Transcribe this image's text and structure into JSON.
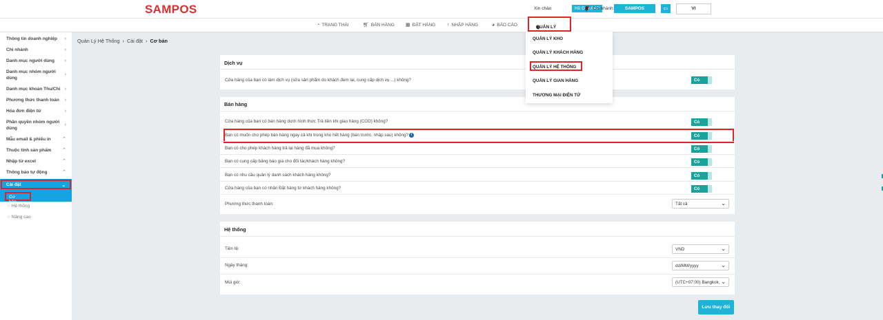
{
  "header": {
    "logo": "SAMPOS",
    "greeting": "Xin chào",
    "user": "Hồ Duy APP",
    "branch_label": "Chi nhánh:",
    "branch": "SAMPOS",
    "language": "VI"
  },
  "nav": {
    "items": [
      {
        "icon": "gauge-icon",
        "label": "TRẠNG THÁI"
      },
      {
        "icon": "cart-icon",
        "label": "BÁN HÀNG"
      },
      {
        "icon": "calendar-icon",
        "label": "ĐẶT HÀNG"
      },
      {
        "icon": "arrow-up-icon",
        "label": "NHẬP HÀNG"
      },
      {
        "icon": "palette-icon",
        "label": "BÁO CÁO"
      }
    ],
    "active": {
      "icon": "gear-icon",
      "label": "QUẢN LÝ"
    },
    "dropdown": [
      "QUẢN LÝ KHO",
      "QUẢN LÝ KHÁCH HÀNG",
      "QUẢN LÝ HỆ THỐNG",
      "QUẢN LÝ GIAN HÀNG",
      "THƯƠNG MẠI ĐIỆN TỬ"
    ]
  },
  "sidebar": {
    "items": [
      "Thông tin doanh nghiệp",
      "Chi nhánh",
      "Danh mục người dùng",
      "Danh mục nhóm người dùng",
      "Danh mục khoản Thu/Chi",
      "Phương thức thanh toán",
      "Hóa đơn điện tử",
      "Phân quyền nhóm người dùng",
      "Mẫu email & phiếu in",
      "Thuộc tính sản phẩm",
      "Nhập từ excel",
      "Thông báo tự động"
    ],
    "active": "Cài đặt",
    "sub": [
      "Cơ bản",
      "Hệ thống",
      "Nâng cao"
    ]
  },
  "breadcrumb": [
    "Quản Lý Hệ Thống",
    "Cài đặt",
    "Cơ bản"
  ],
  "dichvu": {
    "title": "Dịch vụ",
    "rows": [
      {
        "text": "Cửa hàng của bạn có làm dịch vụ (sửa sản phẩm do khách đem lại, cung cấp dịch vụ ...) không?",
        "value": "Có"
      }
    ]
  },
  "banhang": {
    "title": "Bán hàng",
    "rows": [
      {
        "text": "Cửa hàng của bạn có bán hàng dưới hình thức Trả tiền khi giao hàng (COD) không?",
        "value": "Có"
      },
      {
        "text": "Bạn có muốn cho phép bán hàng ngay cả khi trong kho hết hàng (bán trước, nhập sau) không?",
        "value": "Có"
      },
      {
        "text": "Bạn có cho phép khách hàng trả lại hàng đã mua không?",
        "value": "Có"
      },
      {
        "text": "Bạn có cung cấp bảng báo giá cho đối tác/khách hàng không?",
        "value": "Có"
      },
      {
        "text": "Bạn có nhu cầu quản lý danh sách khách hàng không?",
        "value": "Có"
      },
      {
        "text": "Cửa hàng của bạn có nhận Đặt hàng từ khách hàng không?",
        "value": "Có"
      }
    ],
    "payment_label": "Phương thức thanh toán:",
    "payment_value": "Tất cả"
  },
  "hethong": {
    "title": "Hệ thống",
    "rows": [
      {
        "label": "Tiền tệ:",
        "value": "VND"
      },
      {
        "label": "Ngày tháng:",
        "value": "dd/MM/yyyy"
      },
      {
        "label": "Múi giờ:",
        "value": "(UTC+07:00) Bangkok, Hanoi, Jakarta"
      }
    ]
  },
  "save_label": "Lưu thay đổi"
}
